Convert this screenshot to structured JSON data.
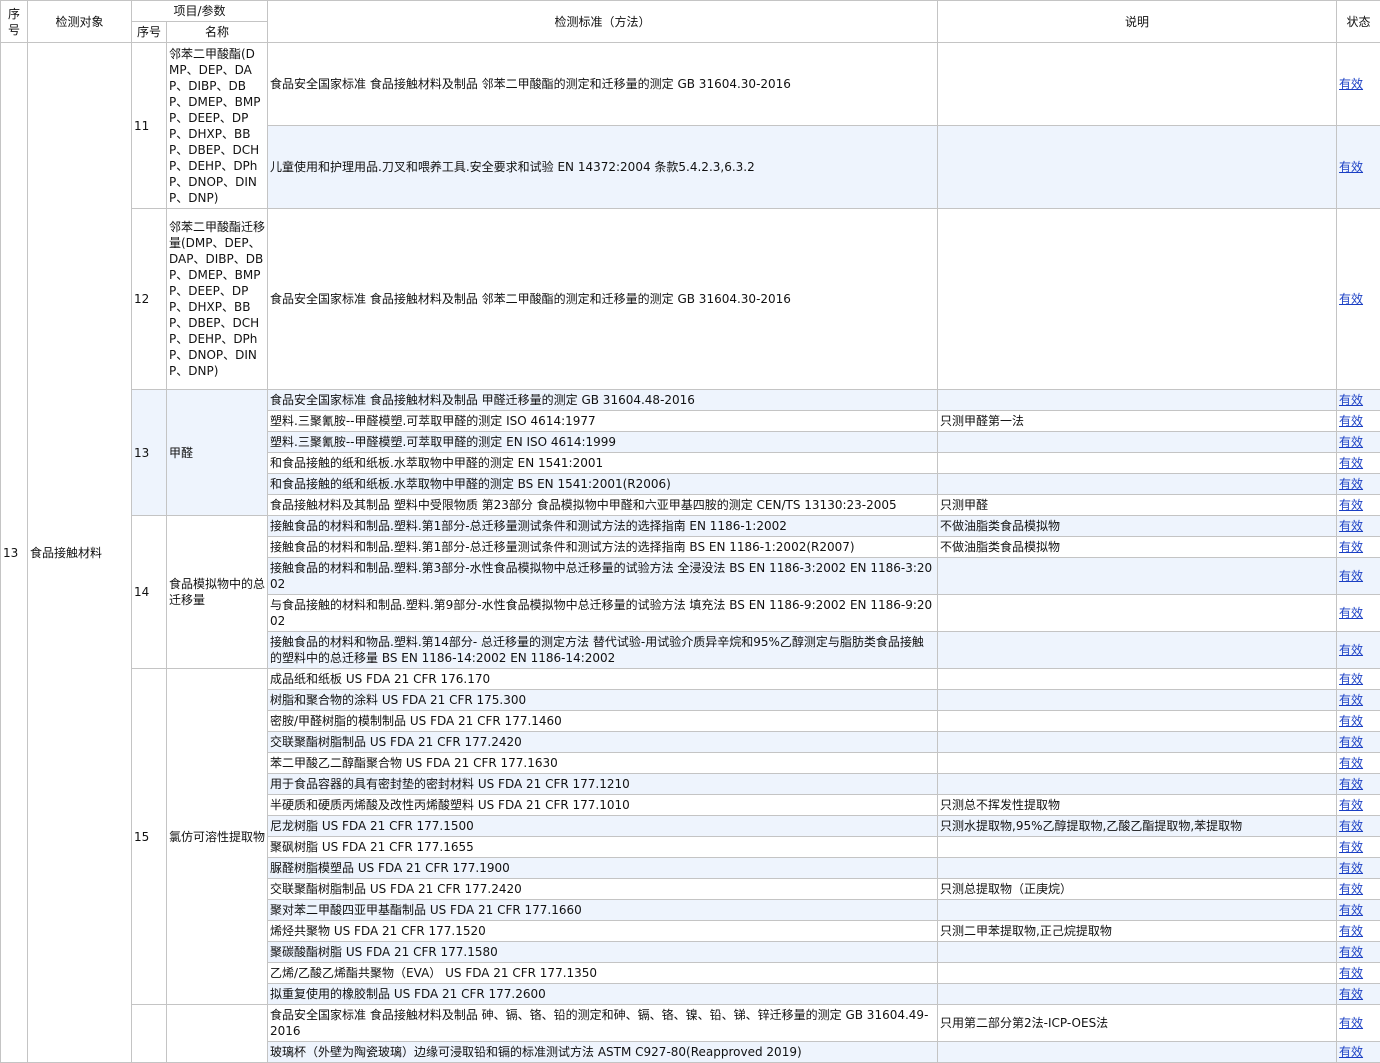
{
  "header": {
    "seq": "序号",
    "object": "检测对象",
    "param_group": "项目/参数",
    "param_seq": "序号",
    "param_name": "名称",
    "standard": "检测标准（方法）",
    "note": "说明",
    "status": "状态"
  },
  "group": {
    "seq": "13",
    "object": "食品接触材料"
  },
  "items": [
    {
      "no": "11",
      "name": "邻苯二甲酸酯(DMP、DEP、DAP、DIBP、DBP、DMEP、BMPP、DEEP、DPP、DHXP、BBP、DBEP、DCHP、DEHP、DPhP、DNOP、DINP、DNP)",
      "rows": [
        {
          "standard": "食品安全国家标准 食品接触材料及制品 邻苯二甲酸酯的测定和迁移量的测定 GB 31604.30-2016",
          "note": "",
          "status": "有效"
        },
        {
          "standard": "儿童使用和护理用品.刀叉和喂养工具.安全要求和试验 EN 14372:2004 条款5.4.2.3,6.3.2",
          "note": "",
          "status": "有效"
        }
      ]
    },
    {
      "no": "12",
      "name": "邻苯二甲酸酯迁移量(DMP、DEP、DAP、DIBP、DBP、DMEP、BMPP、DEEP、DPP、DHXP、BBP、DBEP、DCHP、DEHP、DPhP、DNOP、DINP、DNP)",
      "rows": [
        {
          "standard": "食品安全国家标准 食品接触材料及制品 邻苯二甲酸酯的测定和迁移量的测定 GB 31604.30-2016",
          "note": "",
          "status": "有效"
        }
      ]
    },
    {
      "no": "13",
      "name": "甲醛",
      "rows": [
        {
          "standard": "食品安全国家标准 食品接触材料及制品 甲醛迁移量的测定 GB 31604.48-2016",
          "note": "",
          "status": "有效"
        },
        {
          "standard": "塑料.三聚氰胺--甲醛模塑.可萃取甲醛的测定 ISO 4614:1977",
          "note": "只测甲醛第一法",
          "status": "有效"
        },
        {
          "standard": "塑料.三聚氰胺--甲醛模塑.可萃取甲醛的测定 EN ISO 4614:1999",
          "note": "",
          "status": "有效"
        },
        {
          "standard": "和食品接触的纸和纸板.水萃取物中甲醛的测定 EN 1541:2001",
          "note": "",
          "status": "有效"
        },
        {
          "standard": "和食品接触的纸和纸板.水萃取物中甲醛的测定 BS EN 1541:2001(R2006)",
          "note": "",
          "status": "有效"
        },
        {
          "standard": "食品接触材料及其制品 塑料中受限物质 第23部分 食品模拟物中甲醛和六亚甲基四胺的测定 CEN/TS 13130:23-2005",
          "note": "只测甲醛",
          "status": "有效"
        }
      ]
    },
    {
      "no": "14",
      "name": "食品模拟物中的总迁移量",
      "rows": [
        {
          "standard": "接触食品的材料和制品.塑料.第1部分-总迁移量测试条件和测试方法的选择指南 EN 1186-1:2002",
          "note": "不做油脂类食品模拟物",
          "status": "有效"
        },
        {
          "standard": "接触食品的材料和制品.塑料.第1部分-总迁移量测试条件和测试方法的选择指南 BS EN 1186-1:2002(R2007)",
          "note": "不做油脂类食品模拟物",
          "status": "有效"
        },
        {
          "standard": "接触食品的材料和制品.塑料.第3部分-水性食品模拟物中总迁移量的试验方法 全浸没法 BS EN 1186-3:2002 EN 1186-3:2002",
          "note": "",
          "status": "有效"
        },
        {
          "standard": "与食品接触的材料和制品.塑料.第9部分-水性食品模拟物中总迁移量的试验方法 填充法 BS EN 1186-9:2002 EN 1186-9:2002",
          "note": "",
          "status": "有效"
        },
        {
          "standard": "接触食品的材料和物品.塑料.第14部分- 总迁移量的测定方法 替代试验-用试验介质异辛烷和95%乙醇测定与脂肪类食品接触的塑料中的总迁移量 BS EN 1186-14:2002 EN 1186-14:2002",
          "note": "",
          "status": "有效"
        }
      ]
    },
    {
      "no": "15",
      "name": "氯仿可溶性提取物",
      "rows": [
        {
          "standard": "成品纸和纸板 US FDA 21 CFR 176.170",
          "note": "",
          "status": "有效"
        },
        {
          "standard": "树脂和聚合物的涂料 US FDA 21 CFR 175.300",
          "note": "",
          "status": "有效"
        },
        {
          "standard": "密胺/甲醛树脂的模制制品 US FDA 21 CFR 177.1460",
          "note": "",
          "status": "有效"
        },
        {
          "standard": "交联聚酯树脂制品 US FDA 21 CFR 177.2420",
          "note": "",
          "status": "有效"
        },
        {
          "standard": "苯二甲酸乙二醇酯聚合物 US FDA 21 CFR 177.1630",
          "note": "",
          "status": "有效"
        },
        {
          "standard": "用于食品容器的具有密封垫的密封材料 US FDA 21 CFR 177.1210",
          "note": "",
          "status": "有效"
        },
        {
          "standard": "半硬质和硬质丙烯酸及改性丙烯酸塑料 US FDA 21 CFR 177.1010",
          "note": "只测总不挥发性提取物",
          "status": "有效"
        },
        {
          "standard": "尼龙树脂 US FDA 21 CFR 177.1500",
          "note": "只测水提取物,95%乙醇提取物,乙酸乙酯提取物,苯提取物",
          "status": "有效"
        },
        {
          "standard": "聚砜树脂 US FDA 21 CFR 177.1655",
          "note": "",
          "status": "有效"
        },
        {
          "standard": "脲醛树脂模塑品 US FDA 21 CFR 177.1900",
          "note": "",
          "status": "有效"
        },
        {
          "standard": "交联聚酯树脂制品 US FDA 21 CFR 177.2420",
          "note": "只测总提取物（正庚烷）",
          "status": "有效"
        },
        {
          "standard": "聚对苯二甲酸四亚甲基酯制品 US FDA 21 CFR 177.1660",
          "note": "",
          "status": "有效"
        },
        {
          "standard": "烯烃共聚物 US FDA 21 CFR 177.1520",
          "note": "只测二甲苯提取物,正己烷提取物",
          "status": "有效"
        },
        {
          "standard": "聚碳酸酯树脂 US FDA 21 CFR 177.1580",
          "note": "",
          "status": "有效"
        },
        {
          "standard": "乙烯/乙酸乙烯酯共聚物（EVA） US FDA 21 CFR 177.1350",
          "note": "",
          "status": "有效"
        },
        {
          "standard": "拟重复使用的橡胶制品 US FDA 21 CFR 177.2600",
          "note": "",
          "status": "有效"
        }
      ]
    },
    {
      "no": "",
      "name": "",
      "rows": [
        {
          "standard": "食品安全国家标准 食品接触材料及制品 砷、镉、铬、铅的测定和砷、镉、铬、镍、铅、锑、锌迁移量的测定 GB 31604.49-2016",
          "note": "只用第二部分第2法-ICP-OES法",
          "status": "有效"
        },
        {
          "standard": "玻璃杯（外壁为陶瓷玻璃）边缘可浸取铅和镉的标准测试方法 ASTM C927-80(Reapproved 2019)",
          "note": "",
          "status": "有效"
        }
      ]
    }
  ]
}
